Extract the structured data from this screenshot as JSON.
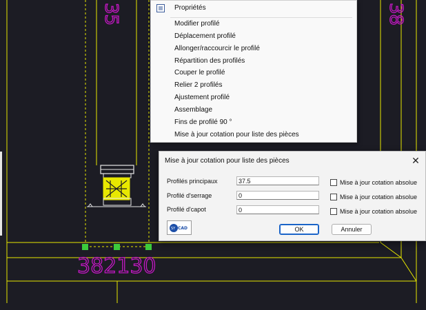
{
  "context_menu": {
    "items": [
      "Propriétés",
      "Modifier profilé",
      "Déplacement profilé",
      "Allonger/raccourcir le profilé",
      "Répartition des profilés",
      "Couper le profilé",
      "Relier 2 profilés",
      "Ajustement profilé",
      "Assemblage",
      "Fins de profilé 90 °",
      "Mise à jour cotation pour liste des pièces"
    ]
  },
  "dialog": {
    "title": "Mise à jour cotation pour liste des pièces",
    "close_glyph": "✕",
    "rows": [
      {
        "label": "Profilés principaux",
        "value": "37.5",
        "checkbox_label": "Mise à jour cotation absolue",
        "checked": false
      },
      {
        "label": "Profilé d'serrage",
        "value": "0",
        "checkbox_label": "Mise à jour cotation absolue",
        "checked": false
      },
      {
        "label": "Profilé d'capot",
        "value": "0",
        "checkbox_label": "Mise à jour cotation absolue",
        "checked": false
      }
    ],
    "ok_label": "OK",
    "cancel_label": "Annuler",
    "logo_text": "SYSCAD"
  },
  "drawing": {
    "dimension_text": "382130",
    "dimension_text_top_left": "35",
    "dimension_text_top_right": "38",
    "colors": {
      "background": "#1c1c24",
      "yellow": "#e8e800",
      "magenta": "#c418c4",
      "grip": "#3ccc3c",
      "white": "#e8e8e8"
    }
  }
}
